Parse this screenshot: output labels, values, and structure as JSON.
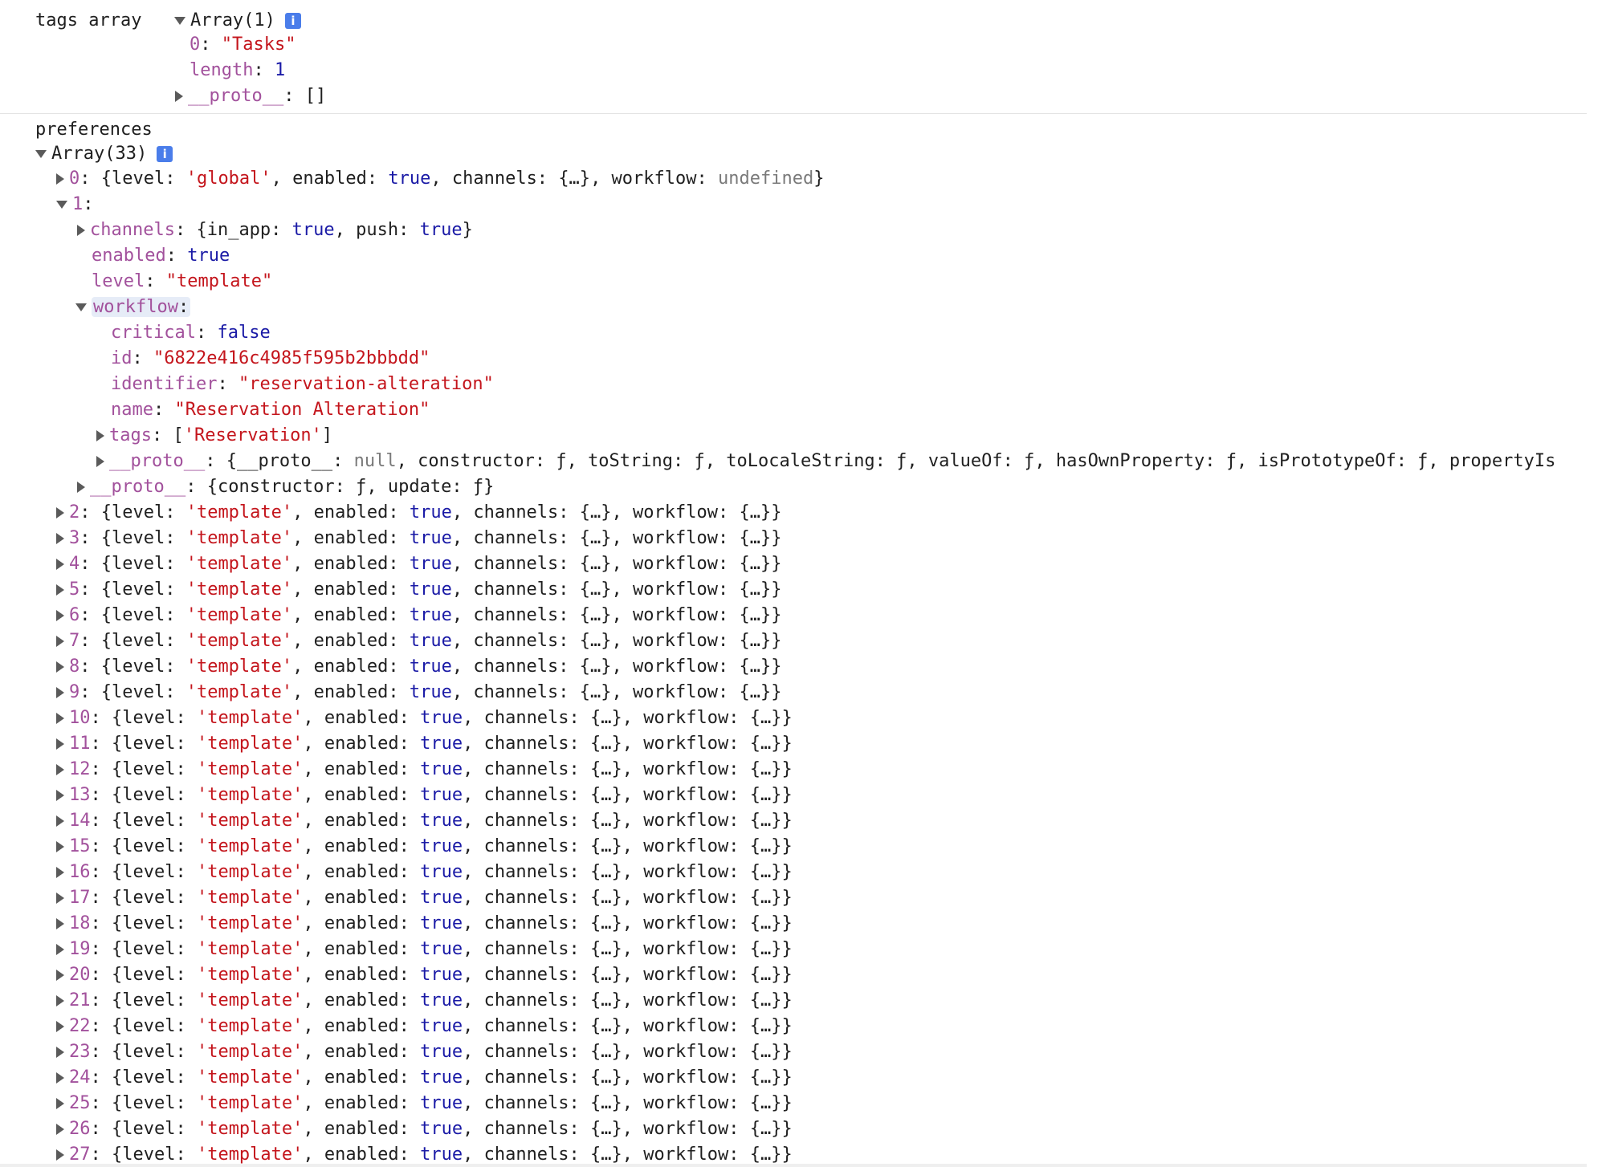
{
  "tags_section": {
    "label": "tags array",
    "array_label": "Array(1)",
    "item0_index": "0",
    "item0_value": "\"Tasks\"",
    "length_key": "length",
    "length_value": "1",
    "proto_key": "__proto__",
    "proto_value": "[]"
  },
  "prefs_section": {
    "label": "preferences",
    "array_label": "Array(33)"
  },
  "item0": {
    "index": "0",
    "level_value": "'global'",
    "enabled_value": "true",
    "channels_value": "{…}",
    "workflow_value": "undefined"
  },
  "item1": {
    "index": "1",
    "channels": {
      "key": "channels",
      "in_app": "true",
      "push": "true"
    },
    "enabled": {
      "key": "enabled",
      "value": "true"
    },
    "level": {
      "key": "level",
      "value": "\"template\""
    },
    "workflow": {
      "key": "workflow",
      "critical": {
        "key": "critical",
        "value": "false"
      },
      "id": {
        "key": "id",
        "value": "\"6822e416c4985f595b2bbbdd\""
      },
      "identifier": {
        "key": "identifier",
        "value": "\"reservation-alteration\""
      },
      "name": {
        "key": "name",
        "value": "\"Reservation Alteration\""
      },
      "tags": {
        "key": "tags",
        "value": "'Reservation'"
      },
      "proto_key": "__proto__",
      "proto_value_tail": "constructor: ƒ, toString: ƒ, toLocaleString: ƒ, valueOf: ƒ, hasOwnProperty: ƒ, isPrototypeOf: ƒ, propertyIs"
    },
    "proto": {
      "key": "__proto__",
      "constructor": "ƒ",
      "update": "ƒ"
    }
  },
  "template_items": [
    "2",
    "3",
    "4",
    "5",
    "6",
    "7",
    "8",
    "9",
    "10",
    "11",
    "12",
    "13",
    "14",
    "15",
    "16",
    "17",
    "18",
    "19",
    "20",
    "21",
    "22",
    "23",
    "24",
    "25",
    "26",
    "27"
  ],
  "template_row": {
    "level_value": "'template'",
    "enabled_value": "true",
    "channels_value": "{…}",
    "workflow_value": "{…}"
  }
}
